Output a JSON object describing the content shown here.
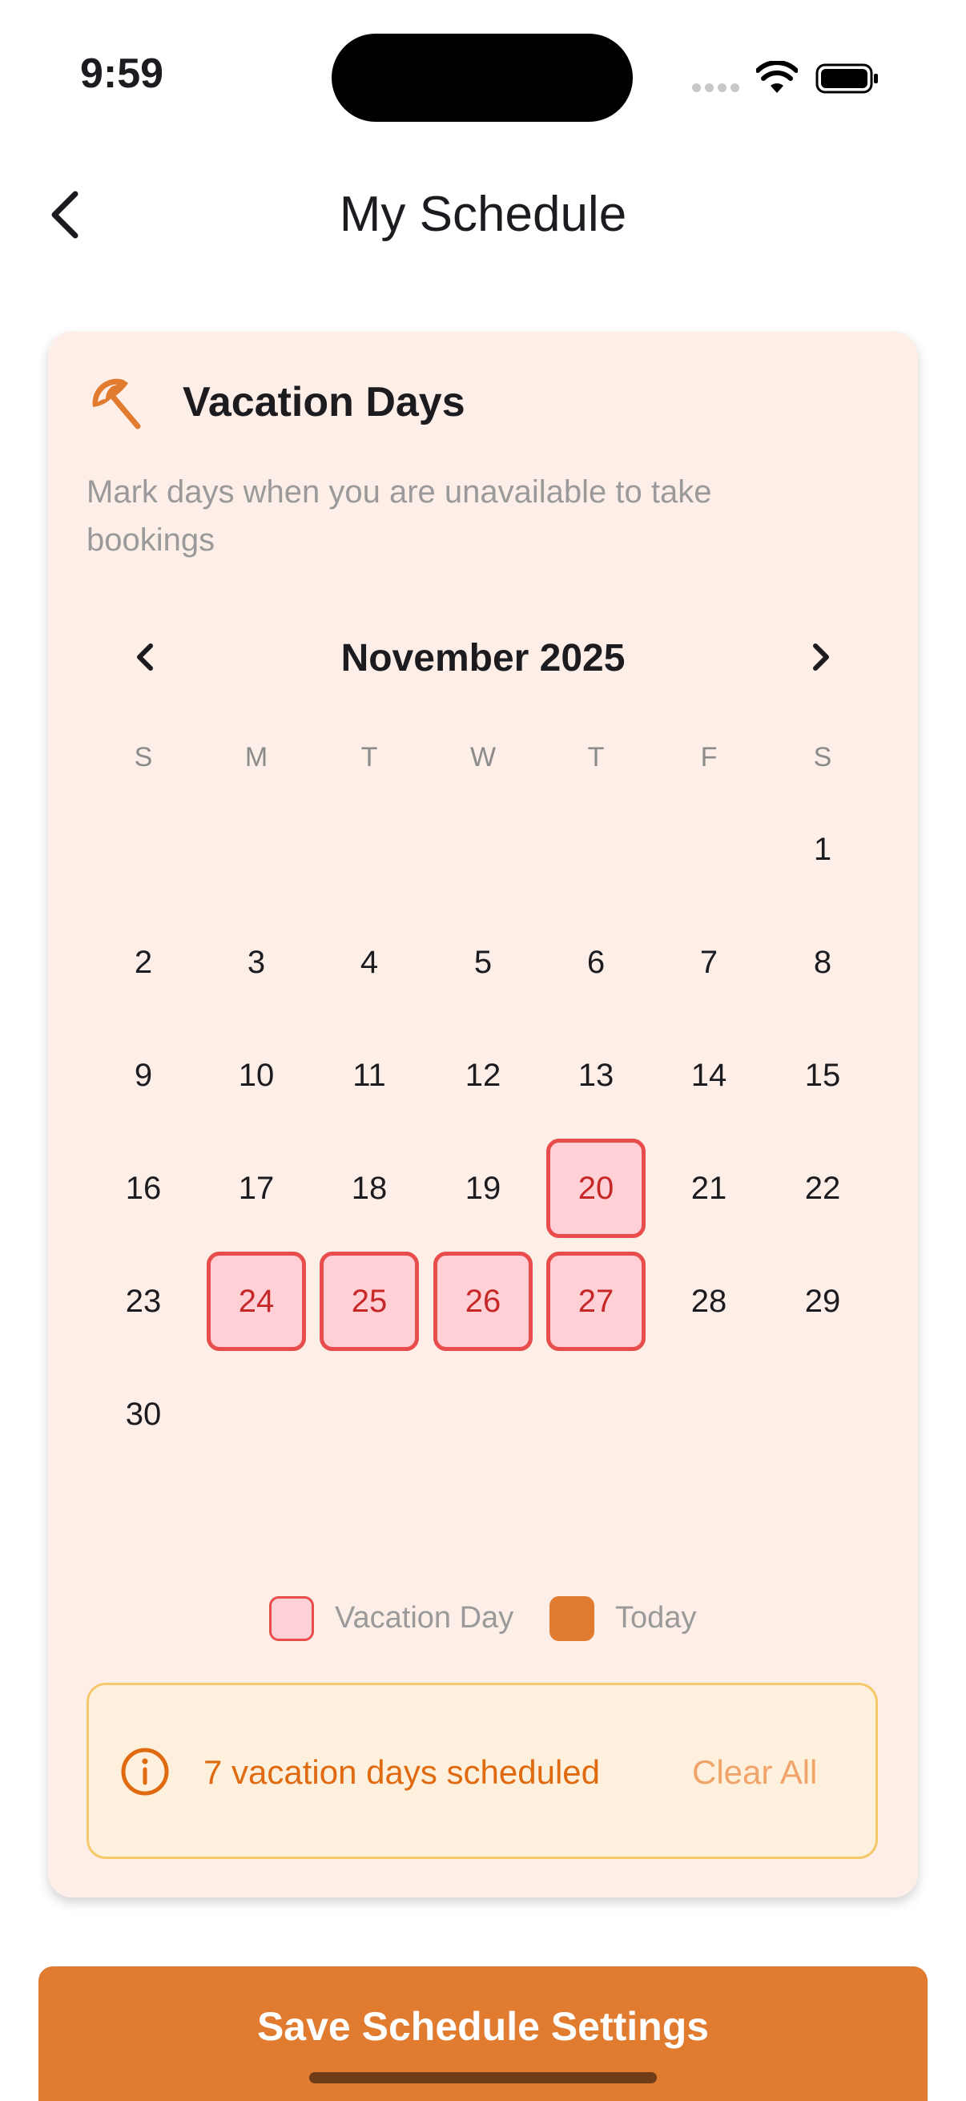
{
  "status_bar": {
    "time": "9:59"
  },
  "header": {
    "title": "My Schedule"
  },
  "card": {
    "title": "Vacation Days",
    "description": "Mark days when you are unavailable to take bookings",
    "icon": "umbrella-icon"
  },
  "calendar": {
    "month_label": "November 2025",
    "weekdays": [
      "S",
      "M",
      "T",
      "W",
      "T",
      "F",
      "S"
    ],
    "first_weekday_index": 6,
    "days_in_month": 30,
    "vacation_days": [
      20,
      24,
      25,
      26,
      27
    ]
  },
  "legend": {
    "vacation_label": "Vacation Day",
    "today_label": "Today"
  },
  "summary": {
    "text": "7 vacation days scheduled",
    "clear_label": "Clear All"
  },
  "save_button": {
    "label": "Save Schedule Settings"
  },
  "colors": {
    "accent": "#e07b30",
    "vacation_fill": "#ffd1d6",
    "vacation_border": "#e84c4c",
    "card_bg": "#fdeee8",
    "summary_bg": "#fdf0dc"
  }
}
